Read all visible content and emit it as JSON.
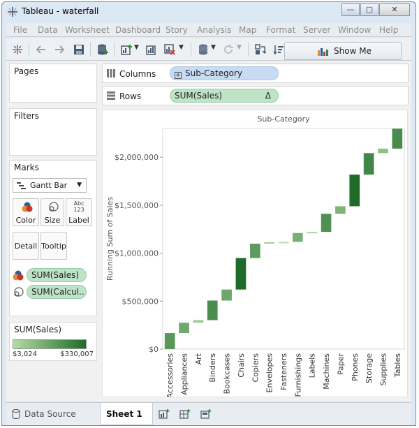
{
  "window": {
    "title": "Tableau - waterfall",
    "controls": [
      "—",
      "▢",
      "✕"
    ]
  },
  "menu": [
    "File",
    "Data",
    "Worksheet",
    "Dashboard",
    "Story",
    "Analysis",
    "Map",
    "Format",
    "Server",
    "Window",
    "Help"
  ],
  "toolbar": {
    "show_me_label": "Show Me"
  },
  "panels": {
    "pages": "Pages",
    "filters": "Filters",
    "marks": "Marks",
    "mark_type": "Gantt Bar",
    "mark_buttons": {
      "color": "Color",
      "size": "Size",
      "label": "Label",
      "detail": "Detail",
      "tooltip": "Tooltip",
      "label_glyph": "Abc\n123"
    },
    "mark_fields": [
      "SUM(Sales)",
      "SUM(Calcul.."
    ]
  },
  "legend": {
    "title": "SUM(Sales)",
    "min": "$3,024",
    "max": "$330,007",
    "color_low": "#b6dba6",
    "color_high": "#1e6b2a"
  },
  "shelves": {
    "columns_label": "Columns",
    "columns_pill": "Sub-Category",
    "rows_label": "Rows",
    "rows_pill": "SUM(Sales)",
    "rows_delta": "Δ"
  },
  "chart_data": {
    "type": "bar",
    "subtype": "waterfall-gantt",
    "title": "Sub-Category",
    "xlabel": "",
    "ylabel": "Running Sum of Sales",
    "ylim": [
      0,
      2300000
    ],
    "yticks": [
      {
        "value": 0,
        "label": "$0"
      },
      {
        "value": 500000,
        "label": "$500,000"
      },
      {
        "value": 1000000,
        "label": "$1,000,000"
      },
      {
        "value": 1500000,
        "label": "$1,500,000"
      },
      {
        "value": 2000000,
        "label": "$2,000,000"
      }
    ],
    "categories": [
      "Accessories",
      "Appliances",
      "Art",
      "Binders",
      "Bookcases",
      "Chairs",
      "Copiers",
      "Envelopes",
      "Fasteners",
      "Furnishings",
      "Labels",
      "Machines",
      "Paper",
      "Phones",
      "Storage",
      "Supplies",
      "Tables"
    ],
    "values": [
      167000,
      108000,
      27000,
      204000,
      115000,
      328000,
      150000,
      16000,
      3024,
      92000,
      12000,
      189000,
      78000,
      330007,
      224000,
      47000,
      207000
    ],
    "grid": false,
    "legend": "none"
  },
  "tabs": {
    "data_source": "Data Source",
    "sheet": "Sheet 1"
  }
}
